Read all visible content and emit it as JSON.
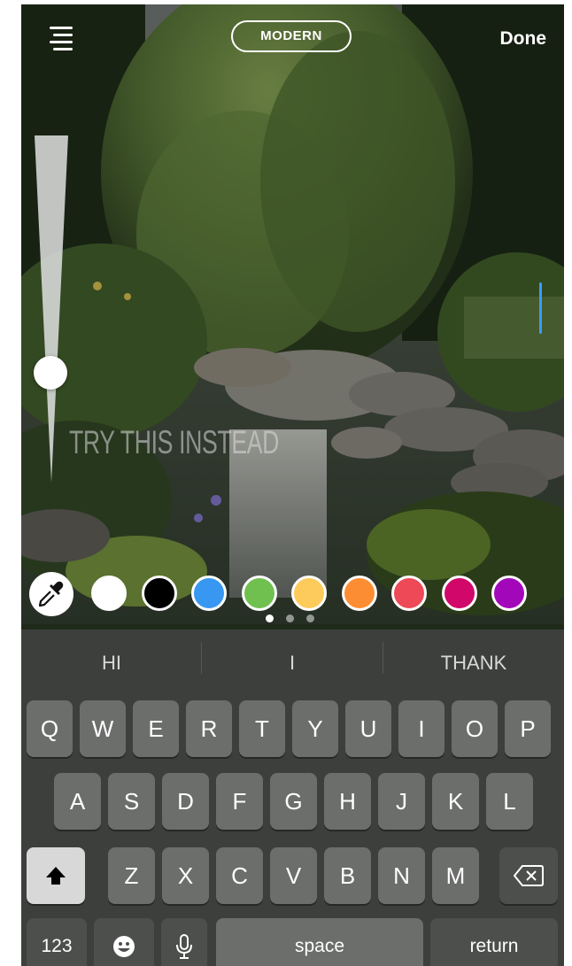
{
  "topbar": {
    "menu_icon": "text-align-lines-icon",
    "style_label": "MODERN",
    "done_label": "Done"
  },
  "caption": {
    "placeholder_text": "TRY THIS INSTEAD"
  },
  "palette": {
    "eyedropper_icon": "eyedropper-icon",
    "colors": [
      "#ffffff",
      "#000000",
      "#3897f0",
      "#70c050",
      "#fdcb5c",
      "#fd8d32",
      "#ed4956",
      "#d10869",
      "#a307ba"
    ],
    "selected_color": "#ffffff",
    "page_count": 3,
    "active_page": 1
  },
  "suggestions": [
    "HI",
    "I",
    "THANK"
  ],
  "keyboard": {
    "row1": [
      "Q",
      "W",
      "E",
      "R",
      "T",
      "Y",
      "U",
      "I",
      "O",
      "P"
    ],
    "row2": [
      "A",
      "S",
      "D",
      "F",
      "G",
      "H",
      "J",
      "K",
      "L"
    ],
    "row3": [
      "Z",
      "X",
      "C",
      "V",
      "B",
      "N",
      "M"
    ],
    "shift_icon": "shift-arrow-icon",
    "delete_icon": "backspace-icon",
    "numbers_label": "123",
    "emoji_icon": "emoji-icon",
    "mic_icon": "microphone-icon",
    "space_label": "space",
    "return_label": "return"
  }
}
